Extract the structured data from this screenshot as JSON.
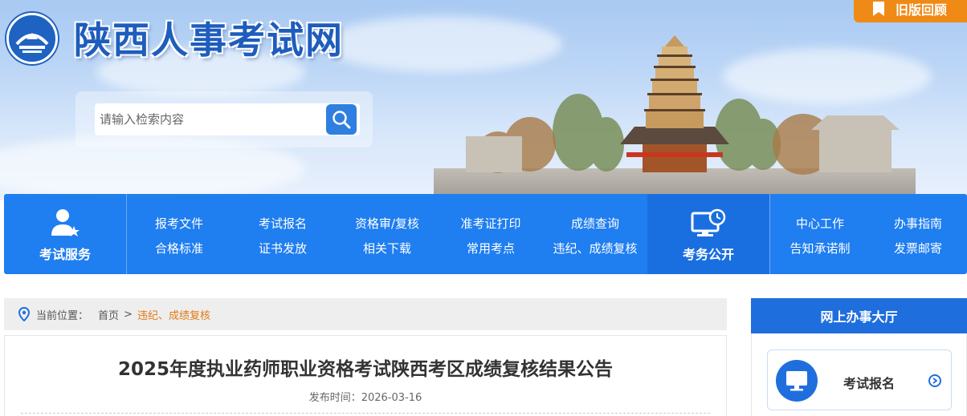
{
  "header": {
    "site_title": "陕西人事考试网",
    "old_version_label": "旧版回顾",
    "search": {
      "placeholder": "请输入检索内容"
    }
  },
  "nav": {
    "exam_service_label": "考试服务",
    "exam_affairs_label": "考务公开",
    "links_row1": [
      "报考文件",
      "考试报名",
      "资格审/复核",
      "准考证打印",
      "成绩查询",
      "中心工作",
      "办事指南"
    ],
    "links_row2": [
      "合格标准",
      "证书发放",
      "相关下载",
      "常用考点",
      "违纪、成绩复核",
      "告知承诺制",
      "发票邮寄"
    ]
  },
  "breadcrumb": {
    "prefix": "当前位置：",
    "home": "首页",
    "separator": ">",
    "current": "违纪、成绩复核"
  },
  "article": {
    "title": "2025年度执业药师职业资格考试陕西考区成绩复核结果公告",
    "date_label": "发布时间：",
    "date": "2026-03-16"
  },
  "sidebar": {
    "panel_title": "网上办事大厅",
    "service_label": "考试报名"
  },
  "colors": {
    "primary_blue": "#1f7ef0",
    "accent_orange": "#f08a17",
    "breadcrumb_current": "#e07b15"
  },
  "icons": {
    "old_version": "bookmark-icon",
    "search": "search-icon",
    "exam_service": "user-star-icon",
    "exam_affairs": "monitor-clock-icon",
    "location": "location-pin-icon",
    "service": "monitor-icon",
    "arrow": "chevron-right-circle-icon"
  }
}
